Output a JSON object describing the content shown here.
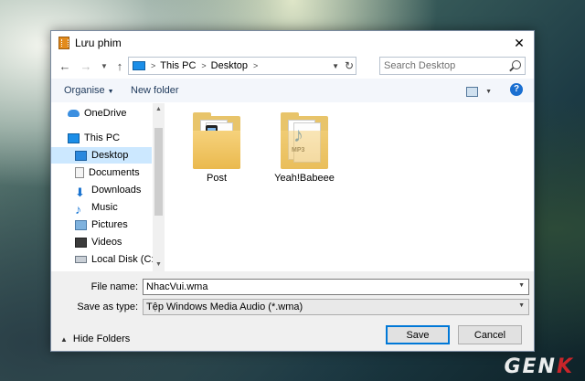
{
  "window": {
    "title": "Lưu phim"
  },
  "nav": {
    "breadcrumb": [
      "This PC",
      "Desktop"
    ],
    "search_placeholder": "Search Desktop"
  },
  "toolbar": {
    "organise": "Organise",
    "new_folder": "New folder"
  },
  "navpane": {
    "items": [
      {
        "label": "OneDrive",
        "icon": "onedrive-icon"
      },
      {
        "label": "This PC",
        "icon": "this-pc-icon"
      },
      {
        "label": "Desktop",
        "icon": "desktop-icon",
        "selected": true
      },
      {
        "label": "Documents",
        "icon": "documents-icon"
      },
      {
        "label": "Downloads",
        "icon": "downloads-icon"
      },
      {
        "label": "Music",
        "icon": "music-icon"
      },
      {
        "label": "Pictures",
        "icon": "pictures-icon"
      },
      {
        "label": "Videos",
        "icon": "videos-icon"
      },
      {
        "label": "Local Disk (C:)",
        "icon": "disk-icon"
      }
    ]
  },
  "files": [
    {
      "label": "Post",
      "icon": "folder-icon"
    },
    {
      "label": "Yeah!Babeee",
      "icon": "folder-music-icon"
    }
  ],
  "form": {
    "file_name_label": "File name:",
    "file_name_value": "NhacVui.wma",
    "save_as_label": "Save as type:",
    "save_as_value": "Tệp Windows Media Audio (*.wma)"
  },
  "footer": {
    "hide_folders": "Hide Folders",
    "save": "Save",
    "cancel": "Cancel"
  },
  "watermark": {
    "text": "GEN",
    "accent": "K"
  },
  "colors": {
    "accent": "#0078d7",
    "selection": "#cce8ff",
    "watermark_accent": "#d9262a"
  }
}
